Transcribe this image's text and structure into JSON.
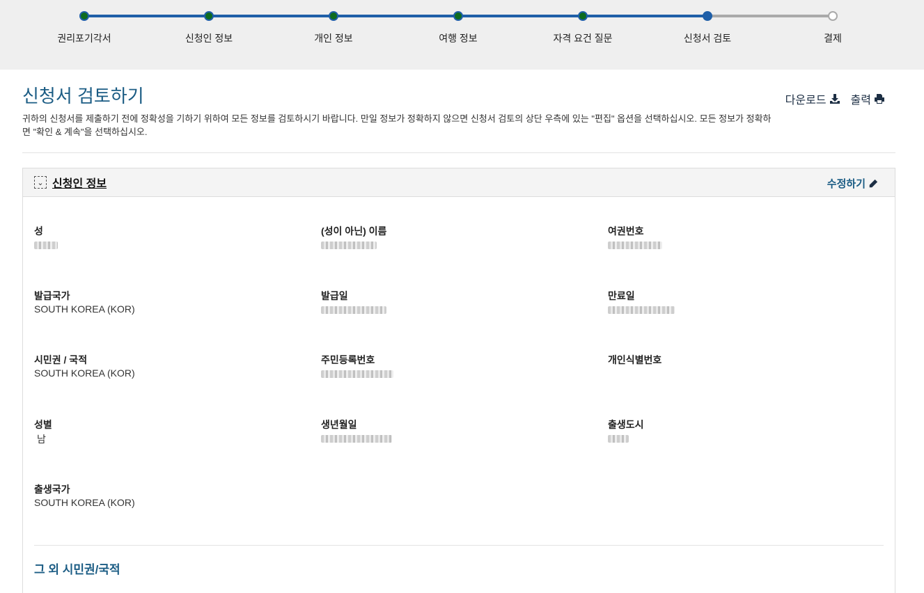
{
  "progress": {
    "steps": [
      {
        "label": "권리포기각서",
        "state": "complete"
      },
      {
        "label": "신청인 정보",
        "state": "complete"
      },
      {
        "label": "개인 정보",
        "state": "complete"
      },
      {
        "label": "여행 정보",
        "state": "complete"
      },
      {
        "label": "자격 요건 질문",
        "state": "complete"
      },
      {
        "label": "신청서 검토",
        "state": "current"
      },
      {
        "label": "결제",
        "state": "pending"
      }
    ],
    "colors": {
      "complete_fill": "#0d6b1f",
      "track": "#1f5fa8",
      "pending": "#a9a9a9"
    }
  },
  "header": {
    "title": "신청서 검토하기",
    "description": "귀하의 신청서를 제출하기 전에 정확성을 기하기 위하여 모든 정보를 검토하시기 바랍니다. 만일 정보가 정확하지 않으면 신청서 검토의 상단 우측에 있는 \"편집\" 옵션을 선택하십시오. 모든 정보가 정확하면 \"확인 & 계속\"을 선택하십시오.",
    "download_label": "다운로드",
    "download_icon": "download-icon",
    "print_label": "출력",
    "print_icon": "print-icon"
  },
  "section": {
    "title": "신청인 정보",
    "toggle_icon": "chevron-down-icon",
    "edit_label": "수정하기",
    "edit_icon": "pencil-icon",
    "fields": [
      {
        "label": "성",
        "value": "",
        "redacted": true
      },
      {
        "label": "(성이 아닌) 이름",
        "value": "",
        "redacted": true
      },
      {
        "label": "여권번호",
        "value": "",
        "redacted": true
      },
      {
        "label": "발급국가",
        "value": "SOUTH KOREA (KOR)",
        "redacted": false
      },
      {
        "label": "발급일",
        "value": "",
        "redacted": true
      },
      {
        "label": "만료일",
        "value": "",
        "redacted": true
      },
      {
        "label": "시민권 / 국적",
        "value": "SOUTH KOREA (KOR)",
        "redacted": false
      },
      {
        "label": "주민등록번호",
        "value": "",
        "redacted": true
      },
      {
        "label": "개인식별번호",
        "value": "",
        "redacted": false
      },
      {
        "label": "성별",
        "value": "남",
        "redacted": false
      },
      {
        "label": "생년월일",
        "value": "",
        "redacted": true
      },
      {
        "label": "출생도시",
        "value": "",
        "redacted": true
      },
      {
        "label": "출생국가",
        "value": "SOUTH KOREA (KOR)",
        "redacted": false
      }
    ],
    "sub_heading": "그 외 시민권/국적"
  },
  "theme": {
    "title_color": "#1b5c84",
    "panel_header_bg": "#f4f4f4"
  }
}
